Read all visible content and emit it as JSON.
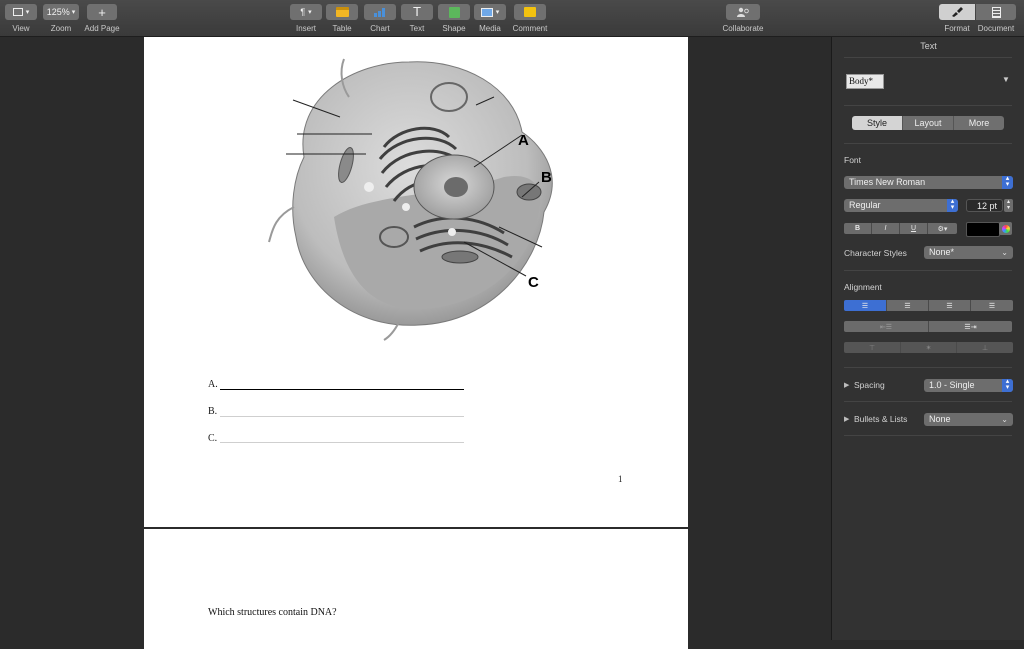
{
  "toolbar": {
    "view_label": "View",
    "zoom_value": "125%",
    "zoom_label": "Zoom",
    "add_page_label": "Add Page",
    "insert_label": "Insert",
    "table_label": "Table",
    "chart_label": "Chart",
    "text_label": "Text",
    "shape_label": "Shape",
    "media_label": "Media",
    "comment_label": "Comment",
    "collaborate_label": "Collaborate",
    "format_label": "Format",
    "document_label": "Document"
  },
  "document": {
    "labels": {
      "a": "A",
      "b": "B",
      "c": "C"
    },
    "answers": [
      {
        "letter": "A."
      },
      {
        "letter": "B."
      },
      {
        "letter": "C."
      }
    ],
    "page_number": "1",
    "question": "Which structures contain DNA?"
  },
  "sidebar": {
    "title": "Text",
    "paragraph_style": "Body*",
    "tabs": [
      "Style",
      "Layout",
      "More"
    ],
    "font_heading": "Font",
    "font_family": "Times New Roman",
    "font_weight": "Regular",
    "font_size": "12 pt",
    "bold": "B",
    "italic": "I",
    "underline": "U",
    "character_styles_label": "Character Styles",
    "character_styles_value": "None*",
    "alignment_heading": "Alignment",
    "spacing_label": "Spacing",
    "spacing_value": "1.0 - Single",
    "bullets_label": "Bullets & Lists",
    "bullets_value": "None"
  },
  "colors": {
    "accent": "#3d6fd3",
    "text_color_well": "#000000",
    "table_icon": "#f2b623",
    "chart_icon": "#4a90d9",
    "shape_icon": "#5cb85c",
    "comment_icon": "#f2c20f"
  }
}
